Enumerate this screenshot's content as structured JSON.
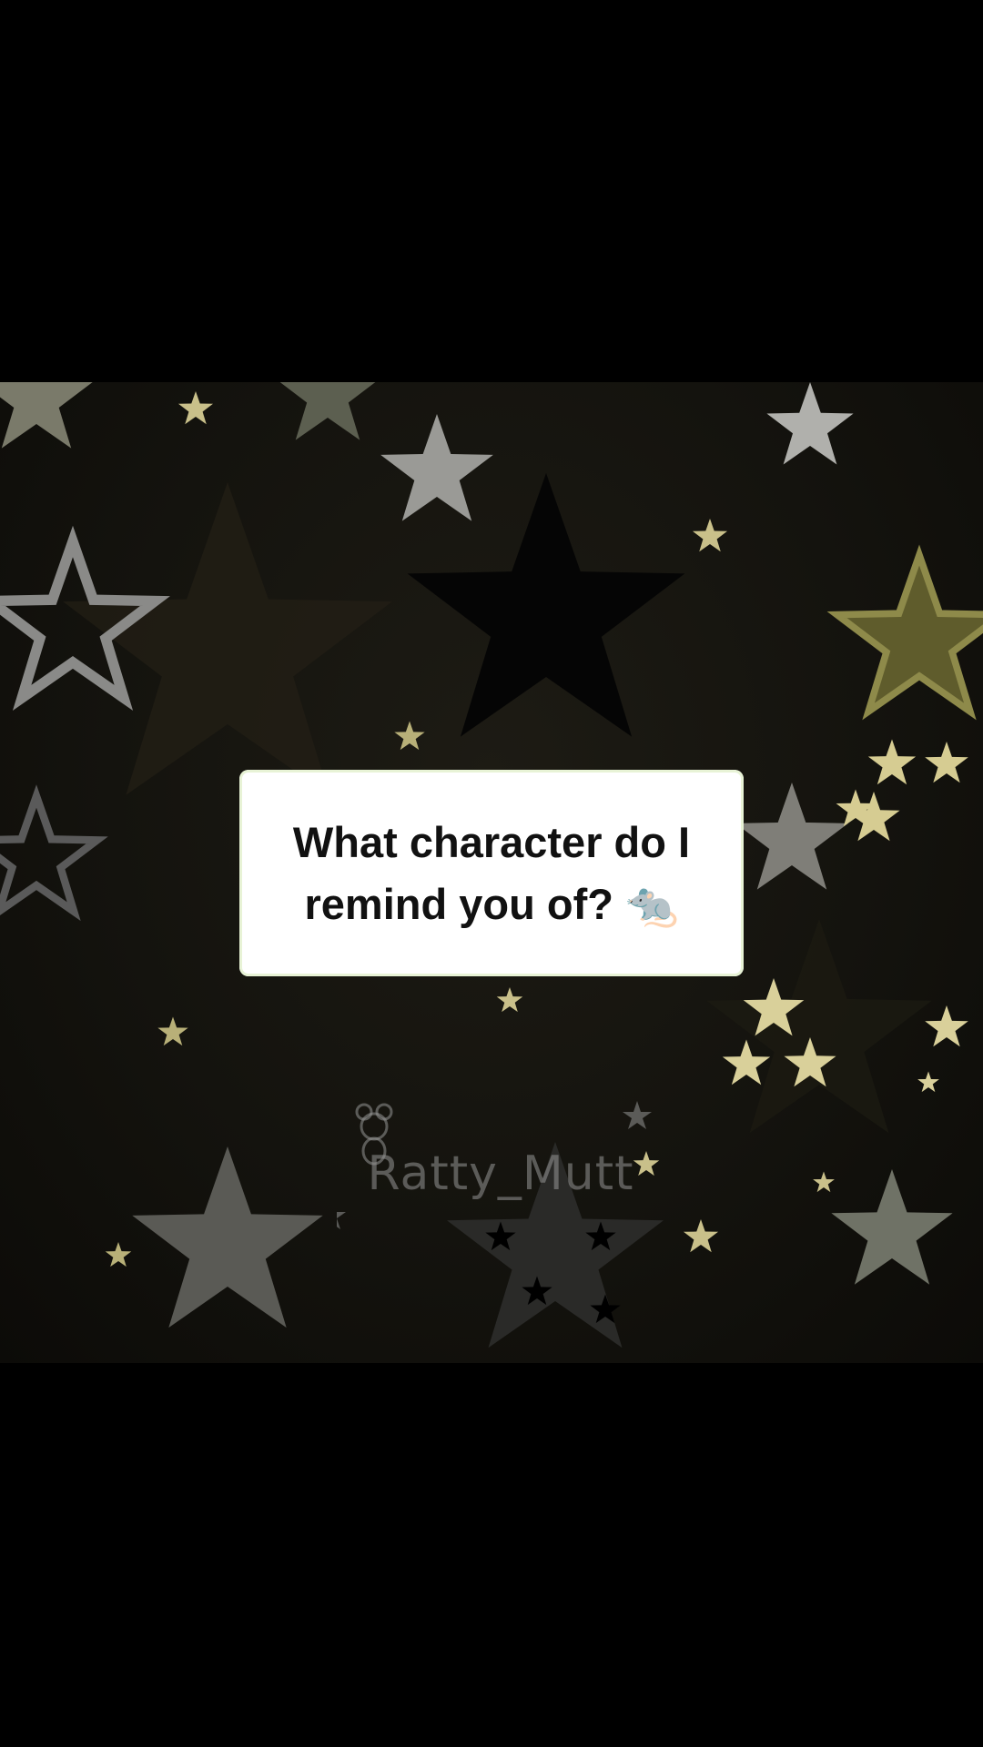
{
  "post": {
    "question": "What character do I remind you of? 🐀"
  },
  "watermark": {
    "username": "Ratty_Mutt"
  },
  "colors": {
    "background": "#000000",
    "card": "#ffffff",
    "text": "#111111",
    "star_cream": "#c9c08a",
    "star_silver": "#9a9a96",
    "star_olive": "#6b6a3a"
  }
}
